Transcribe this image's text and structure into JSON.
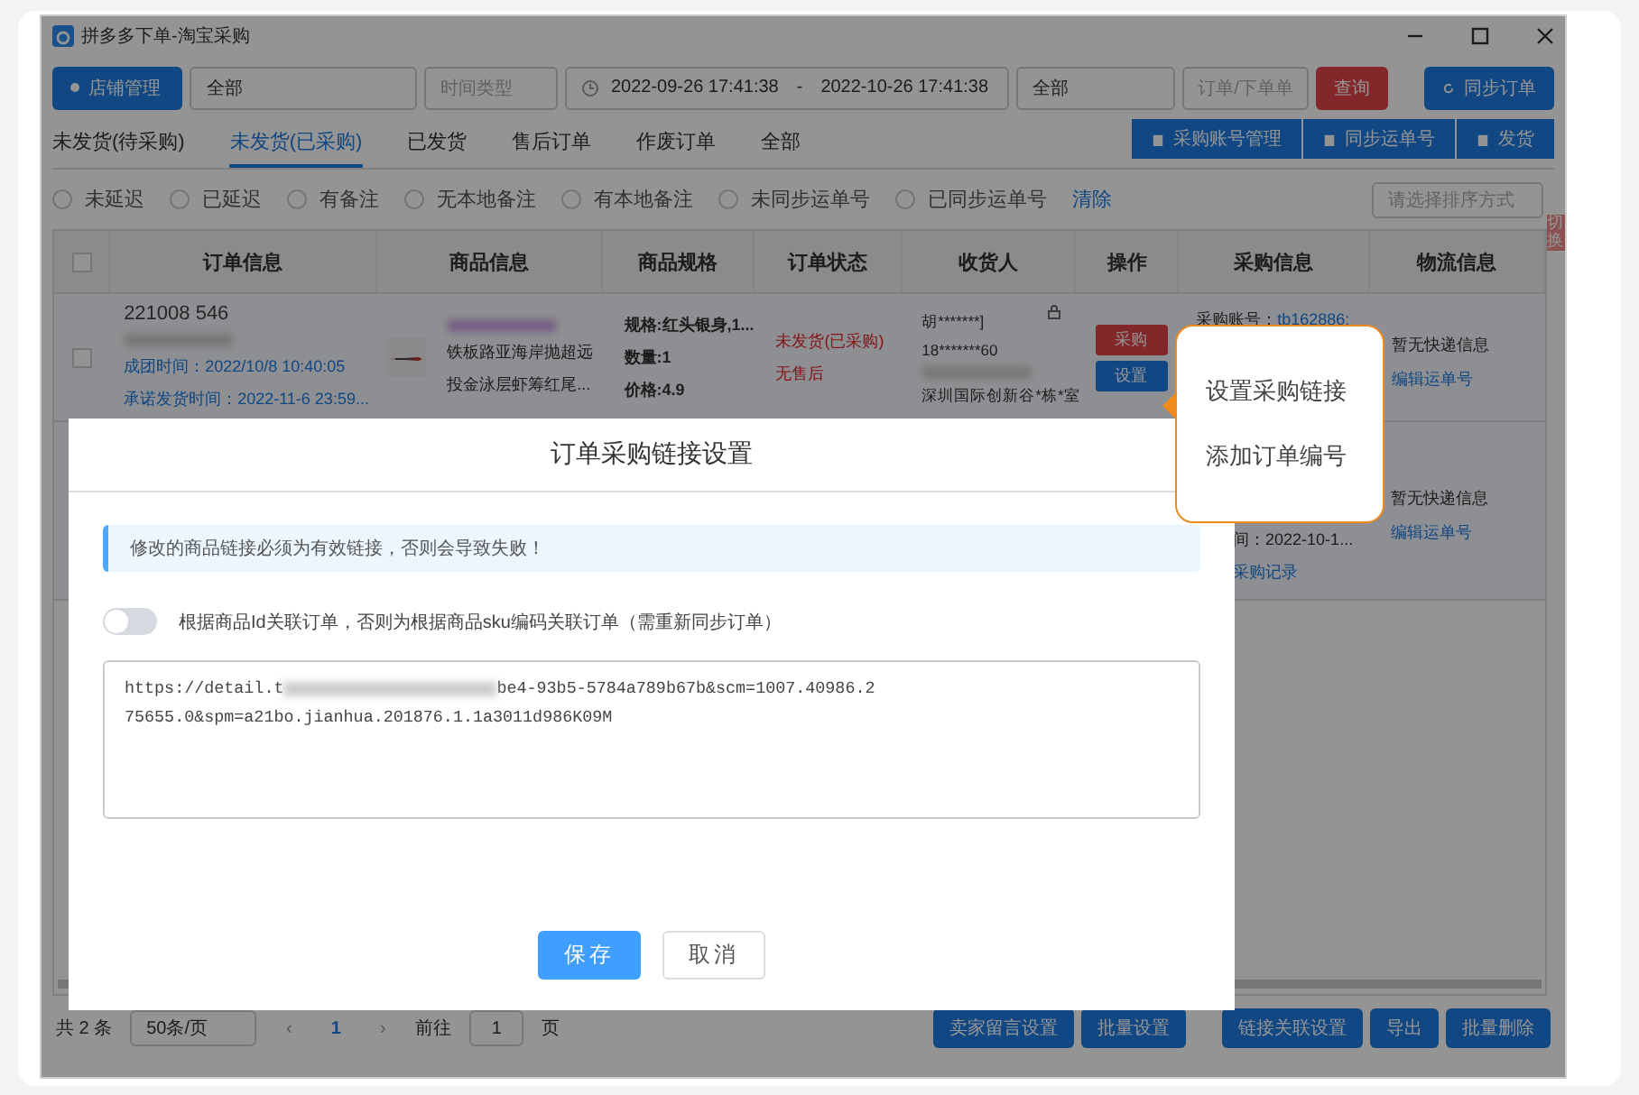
{
  "window": {
    "title": "拼多多下单-淘宝采购"
  },
  "toolbar": {
    "shop_button": "店铺管理",
    "shop_select": "全部",
    "time_type_placeholder": "时间类型",
    "date_start": "2022-09-26 17:41:38",
    "date_separator": "-",
    "date_end": "2022-10-26 17:41:38",
    "status_select": "全部",
    "order_placeholder": "订单/下单单",
    "query_button": "查询",
    "sync_button": "同步订单"
  },
  "tabs": [
    {
      "label": "未发货(待采购)",
      "selected": false
    },
    {
      "label": "未发货(已采购)",
      "selected": true
    },
    {
      "label": "已发货",
      "selected": false
    },
    {
      "label": "售后订单",
      "selected": false
    },
    {
      "label": "作废订单",
      "selected": false
    },
    {
      "label": "全部",
      "selected": false
    }
  ],
  "actions": [
    "采购账号管理",
    "同步运单号",
    "发货"
  ],
  "filters": [
    {
      "label": "未延迟",
      "checked": false
    },
    {
      "label": "已延迟",
      "checked": false
    },
    {
      "label": "有备注",
      "checked": false
    },
    {
      "label": "无本地备注",
      "checked": false
    },
    {
      "label": "有本地备注",
      "checked": false
    },
    {
      "label": "未同步运单号",
      "checked": false
    },
    {
      "label": "已同步运单号",
      "checked": false
    }
  ],
  "clear_link": "清除",
  "sort_placeholder": "请选择排序方式",
  "side_tag": "切换",
  "table": {
    "select_all_checked": false,
    "columns": [
      "订单信息",
      "商品信息",
      "商品规格",
      "订单状态",
      "收货人",
      "操作",
      "采购信息",
      "物流信息"
    ],
    "rows": [
      {
        "checked": false,
        "order_no": "221008 546",
        "group_time": "成团时间：2022/10/8 10:40:05",
        "ship_deadline": "承诺发货时间：2022-11-6 23:59...",
        "product_lines": [
          "铁板路亚海岸抛超远",
          "投金泳层虾筹红尾..."
        ],
        "spec_lines": [
          "规格:红头银身,1...",
          "数量:1",
          "价格:4.9"
        ],
        "status_lines": [
          "未发货(已采购)",
          "无售后"
        ],
        "receiver_lines": [
          "胡*******]",
          "18*******60",
          "深圳国际创新谷*栋*室"
        ],
        "buttons": [
          "采购",
          "设置"
        ],
        "purchase_label": "采购账号：",
        "purchase_link": "tb162886:",
        "logistics_text": "暂无快递信息",
        "logistics_link": "编辑运单号"
      },
      {
        "purchase_time": "间：2022-10-1...",
        "purchase_record": "采购记录",
        "logistics_text": "暂无快递信息",
        "logistics_link": "编辑运单号"
      }
    ]
  },
  "footer": {
    "total": "共 2 条",
    "page_size": "50条/页",
    "prev_page": "‹",
    "current_page": "1",
    "next_page": "›",
    "goto_label": "前往",
    "goto_value": "1",
    "page_unit": "页",
    "buttons": [
      "卖家留言设置",
      "批量设置",
      "链接关联设置",
      "导出",
      "批量删除"
    ]
  },
  "dialog": {
    "title": "订单采购链接设置",
    "notice": "修改的商品链接必须为有效链接，否则会导致失败！",
    "switch_on": false,
    "switch_label": "根据商品Id关联订单，否则为根据商品sku编码关联订单（需重新同步订单）",
    "url_start": "https://detail.t",
    "url_end": "be4-93b5-5784a789b67b&scm=1007.40986.2",
    "url_line2": "75655.0&spm=a21bo.jianhua.201876.1.1a3011d986K09M",
    "save_button": "保存",
    "cancel_button": "取消"
  },
  "tooltip": {
    "items": [
      "设置采购链接",
      "添加订单编号"
    ]
  }
}
